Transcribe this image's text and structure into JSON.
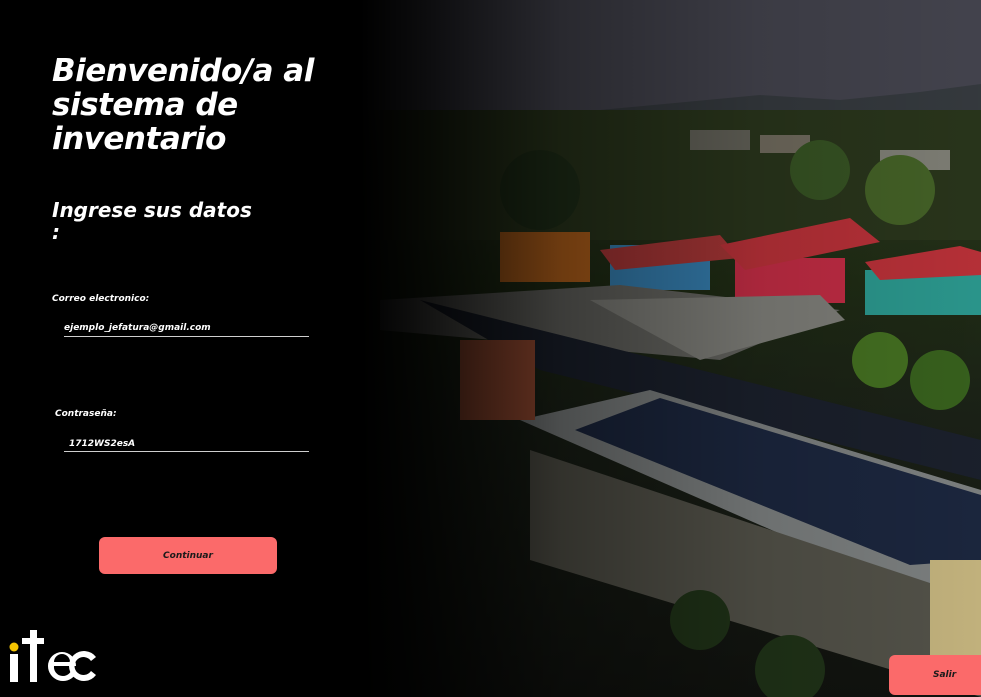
{
  "page": {
    "title": "Bienvenido/a al sistema de inventario",
    "subtitle": "Ingrese sus datos :"
  },
  "form": {
    "email_label": "Correo electronico:",
    "email_value": "ejemplo_jefatura@gmail.com",
    "password_label": "Contraseña:",
    "password_value": "1712WS2esA",
    "submit_label": "Continuar"
  },
  "footer": {
    "exit_label": "Salir",
    "logo_text": "itec"
  },
  "colors": {
    "accent": "#fb6a6a",
    "background": "#000000",
    "text": "#ffffff",
    "logo_dot": "#f5c400"
  }
}
